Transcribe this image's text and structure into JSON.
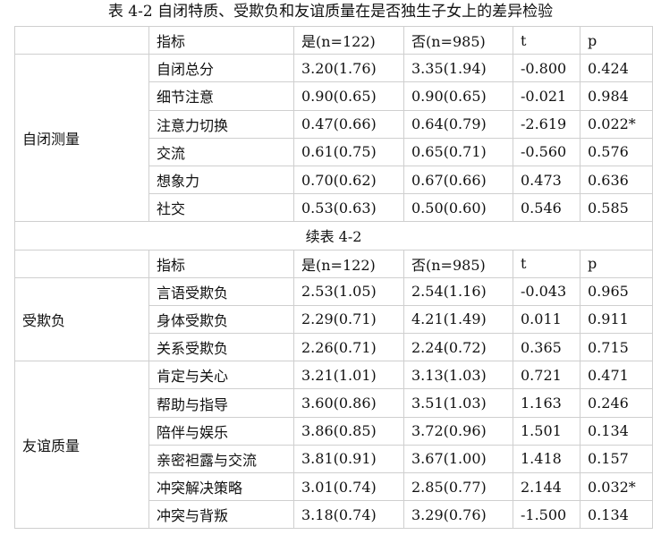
{
  "title": "表 4-2   自闭特质、受欺负和友谊质量在是否独生子女上的差异检验",
  "header": {
    "indicator": "指标",
    "yes": "是(n=122)",
    "no": "否(n=985)",
    "t": "t",
    "p": "p"
  },
  "continued_label": "续表 4-2",
  "section1": {
    "group": "自闭测量",
    "rows": [
      {
        "name": "自闭总分",
        "yes": "3.20(1.76)",
        "no": "3.35(1.94)",
        "t": "-0.800",
        "p": "0.424"
      },
      {
        "name": "细节注意",
        "yes": "0.90(0.65)",
        "no": "0.90(0.65)",
        "t": "-0.021",
        "p": "0.984"
      },
      {
        "name": "注意力切换",
        "yes": "0.47(0.66)",
        "no": "0.64(0.79)",
        "t": "-2.619",
        "p": "0.022*"
      },
      {
        "name": "交流",
        "yes": "0.61(0.75)",
        "no": "0.65(0.71)",
        "t": "-0.560",
        "p": "0.576"
      },
      {
        "name": "想象力",
        "yes": "0.70(0.62)",
        "no": "0.67(0.66)",
        "t": "0.473",
        "p": "0.636"
      },
      {
        "name": "社交",
        "yes": "0.53(0.63)",
        "no": "0.50(0.60)",
        "t": "0.546",
        "p": "0.585"
      }
    ]
  },
  "section2": {
    "group": "受欺负",
    "rows": [
      {
        "name": "言语受欺负",
        "yes": "2.53(1.05)",
        "no": "2.54(1.16)",
        "t": "-0.043",
        "p": "0.965"
      },
      {
        "name": "身体受欺负",
        "yes": "2.29(0.71)",
        "no": "4.21(1.49)",
        "t": "0.011",
        "p": "0.911"
      },
      {
        "name": "关系受欺负",
        "yes": "2.26(0.71)",
        "no": "2.24(0.72)",
        "t": "0.365",
        "p": "0.715"
      }
    ]
  },
  "section3": {
    "group": "友谊质量",
    "rows": [
      {
        "name": "肯定与关心",
        "yes": "3.21(1.01)",
        "no": "3.13(1.03)",
        "t": "0.721",
        "p": "0.471"
      },
      {
        "name": "帮助与指导",
        "yes": "3.60(0.86)",
        "no": "3.51(1.03)",
        "t": "1.163",
        "p": "0.246"
      },
      {
        "name": "陪伴与娱乐",
        "yes": "3.86(0.85)",
        "no": "3.72(0.96)",
        "t": "1.501",
        "p": "0.134"
      },
      {
        "name": "亲密袒露与交流",
        "yes": "3.81(0.91)",
        "no": "3.67(1.00)",
        "t": "1.418",
        "p": "0.157"
      },
      {
        "name": "冲突解决策略",
        "yes": "3.01(0.74)",
        "no": "2.85(0.77)",
        "t": "2.144",
        "p": "0.032*"
      },
      {
        "name": "冲突与背叛",
        "yes": "3.18(0.74)",
        "no": "3.29(0.76)",
        "t": "-1.500",
        "p": "0.134"
      }
    ]
  }
}
